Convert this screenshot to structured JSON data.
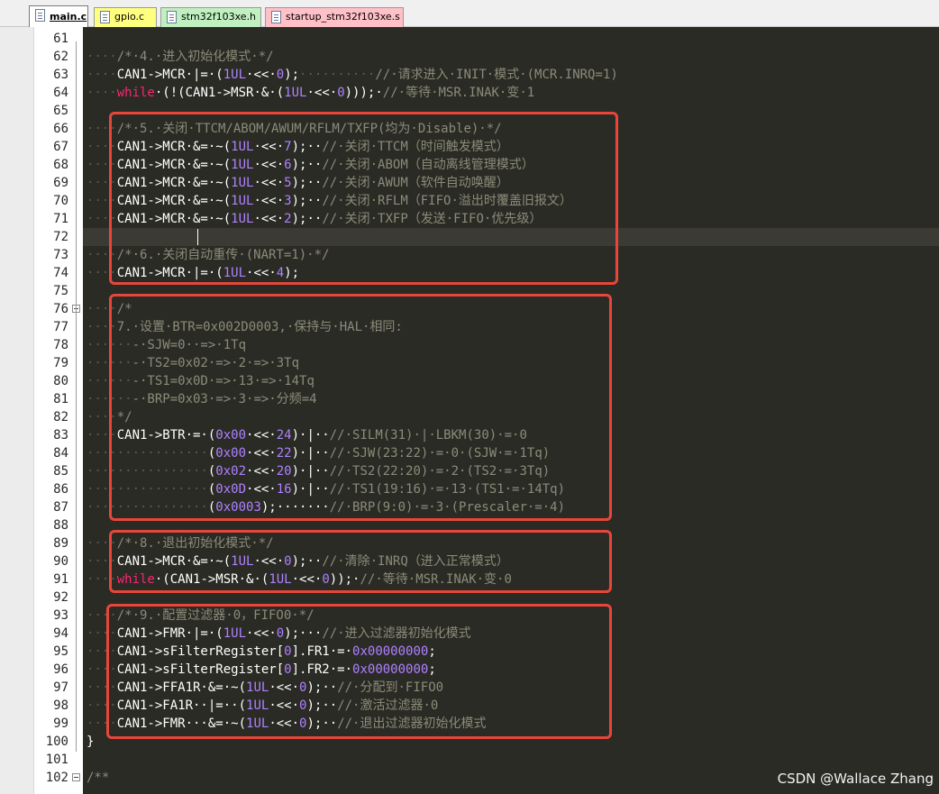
{
  "tabs": [
    {
      "label": "main.c",
      "active": true,
      "color": "#ffffff"
    },
    {
      "label": "gpio.c",
      "active": false,
      "color": "#ffff80"
    },
    {
      "label": "stm32f103xe.h",
      "active": false,
      "color": "#c0f0c0"
    },
    {
      "label": "startup_stm32f103xe.s",
      "active": false,
      "color": "#ffc0c8"
    }
  ],
  "colors": {
    "editor_bg": "#2b2b25",
    "comment": "#8b8b7a",
    "keyword": "#f92672",
    "number": "#ae81ff",
    "text": "#ffffff",
    "highlight_box": "#e8463a"
  },
  "lines": [
    {
      "n": "61",
      "t": []
    },
    {
      "n": "62",
      "t": [
        [
          "ws",
          "····"
        ],
        [
          "c",
          "/*·4.·进入初始化模式·*/"
        ]
      ]
    },
    {
      "n": "63",
      "t": [
        [
          "ws",
          "····"
        ],
        [
          "",
          "CAN1->MCR·|=·("
        ],
        [
          "n",
          "1UL"
        ],
        [
          "",
          "·<<·"
        ],
        [
          "n",
          "0"
        ],
        [
          "",
          ");"
        ],
        [
          "ws",
          "··········"
        ],
        [
          "c",
          "//·请求进入·INIT·模式·(MCR.INRQ=1)"
        ]
      ]
    },
    {
      "n": "64",
      "t": [
        [
          "ws",
          "····"
        ],
        [
          "k",
          "while"
        ],
        [
          "",
          "·(!(CAN1->MSR·&·("
        ],
        [
          "n",
          "1UL"
        ],
        [
          "",
          "·<<·"
        ],
        [
          "n",
          "0"
        ],
        [
          "",
          ")));·"
        ],
        [
          "c",
          "//·等待·MSR.INAK·变·1"
        ]
      ]
    },
    {
      "n": "65",
      "t": []
    },
    {
      "n": "66",
      "t": [
        [
          "ws",
          "····"
        ],
        [
          "c",
          "/*·5.·关闭·TTCM/ABOM/AWUM/RFLM/TXFP(均为·Disable)·*/"
        ]
      ]
    },
    {
      "n": "67",
      "t": [
        [
          "ws",
          "····"
        ],
        [
          "",
          "CAN1->MCR·&=·~("
        ],
        [
          "n",
          "1UL"
        ],
        [
          "",
          "·<<·"
        ],
        [
          "n",
          "7"
        ],
        [
          "",
          ");··"
        ],
        [
          "c",
          "//·关闭·TTCM（时间触发模式）"
        ]
      ]
    },
    {
      "n": "68",
      "t": [
        [
          "ws",
          "····"
        ],
        [
          "",
          "CAN1->MCR·&=·~("
        ],
        [
          "n",
          "1UL"
        ],
        [
          "",
          "·<<·"
        ],
        [
          "n",
          "6"
        ],
        [
          "",
          ");··"
        ],
        [
          "c",
          "//·关闭·ABOM（自动离线管理模式）"
        ]
      ]
    },
    {
      "n": "69",
      "t": [
        [
          "ws",
          "····"
        ],
        [
          "",
          "CAN1->MCR·&=·~("
        ],
        [
          "n",
          "1UL"
        ],
        [
          "",
          "·<<·"
        ],
        [
          "n",
          "5"
        ],
        [
          "",
          ");··"
        ],
        [
          "c",
          "//·关闭·AWUM（软件自动唤醒）"
        ]
      ]
    },
    {
      "n": "70",
      "t": [
        [
          "ws",
          "····"
        ],
        [
          "",
          "CAN1->MCR·&=·~("
        ],
        [
          "n",
          "1UL"
        ],
        [
          "",
          "·<<·"
        ],
        [
          "n",
          "3"
        ],
        [
          "",
          ");··"
        ],
        [
          "c",
          "//·关闭·RFLM（FIFO·溢出时覆盖旧报文）"
        ]
      ]
    },
    {
      "n": "71",
      "t": [
        [
          "ws",
          "····"
        ],
        [
          "",
          "CAN1->MCR·&=·~("
        ],
        [
          "n",
          "1UL"
        ],
        [
          "",
          "·<<·"
        ],
        [
          "n",
          "2"
        ],
        [
          "",
          ");··"
        ],
        [
          "c",
          "//·关闭·TXFP（发送·FIFO·优先级）"
        ]
      ]
    },
    {
      "n": "72",
      "t": [],
      "current": true
    },
    {
      "n": "73",
      "t": [
        [
          "ws",
          "····"
        ],
        [
          "c",
          "/*·6.·关闭自动重传·(NART=1)·*/"
        ]
      ]
    },
    {
      "n": "74",
      "t": [
        [
          "ws",
          "····"
        ],
        [
          "",
          "CAN1->MCR·|=·("
        ],
        [
          "n",
          "1UL"
        ],
        [
          "",
          "·<<·"
        ],
        [
          "n",
          "4"
        ],
        [
          "",
          ");"
        ]
      ]
    },
    {
      "n": "75",
      "t": []
    },
    {
      "n": "76",
      "t": [
        [
          "ws",
          "····"
        ],
        [
          "c",
          "/*"
        ]
      ],
      "fold": true
    },
    {
      "n": "77",
      "t": [
        [
          "ws",
          "····"
        ],
        [
          "c",
          "7.·设置·BTR=0x002D0003,·保持与·HAL·相同:"
        ]
      ]
    },
    {
      "n": "78",
      "t": [
        [
          "ws",
          "······"
        ],
        [
          "c",
          "-·SJW=0··=>·1Tq"
        ]
      ]
    },
    {
      "n": "79",
      "t": [
        [
          "ws",
          "······"
        ],
        [
          "c",
          "-·TS2=0x02·=>·2·=>·3Tq"
        ]
      ]
    },
    {
      "n": "80",
      "t": [
        [
          "ws",
          "······"
        ],
        [
          "c",
          "-·TS1=0x0D·=>·13·=>·14Tq"
        ]
      ]
    },
    {
      "n": "81",
      "t": [
        [
          "ws",
          "······"
        ],
        [
          "c",
          "-·BRP=0x03·=>·3·=>·分频=4"
        ]
      ]
    },
    {
      "n": "82",
      "t": [
        [
          "ws",
          "····"
        ],
        [
          "c",
          "*/"
        ]
      ]
    },
    {
      "n": "83",
      "t": [
        [
          "ws",
          "····"
        ],
        [
          "",
          "CAN1->BTR·=·("
        ],
        [
          "n",
          "0x00"
        ],
        [
          "",
          "·<<·"
        ],
        [
          "n",
          "24"
        ],
        [
          "",
          ")·|··"
        ],
        [
          "c",
          "//·SILM(31)·|·LBKM(30)·=·0"
        ]
      ]
    },
    {
      "n": "84",
      "t": [
        [
          "ws",
          "················"
        ],
        [
          "",
          "("
        ],
        [
          "n",
          "0x00"
        ],
        [
          "",
          "·<<·"
        ],
        [
          "n",
          "22"
        ],
        [
          "",
          ")·|··"
        ],
        [
          "c",
          "//·SJW(23:22)·=·0·(SJW·=·1Tq)"
        ]
      ]
    },
    {
      "n": "85",
      "t": [
        [
          "ws",
          "················"
        ],
        [
          "",
          "("
        ],
        [
          "n",
          "0x02"
        ],
        [
          "",
          "·<<·"
        ],
        [
          "n",
          "20"
        ],
        [
          "",
          ")·|··"
        ],
        [
          "c",
          "//·TS2(22:20)·=·2·(TS2·=·3Tq)"
        ]
      ]
    },
    {
      "n": "86",
      "t": [
        [
          "ws",
          "················"
        ],
        [
          "",
          "("
        ],
        [
          "n",
          "0x0D"
        ],
        [
          "",
          "·<<·"
        ],
        [
          "n",
          "16"
        ],
        [
          "",
          ")·|··"
        ],
        [
          "c",
          "//·TS1(19:16)·=·13·(TS1·=·14Tq)"
        ]
      ]
    },
    {
      "n": "87",
      "t": [
        [
          "ws",
          "················"
        ],
        [
          "",
          "("
        ],
        [
          "n",
          "0x0003"
        ],
        [
          "",
          ");·······"
        ],
        [
          "c",
          "//·BRP(9:0)·=·3·(Prescaler·=·4)"
        ]
      ]
    },
    {
      "n": "88",
      "t": []
    },
    {
      "n": "89",
      "t": [
        [
          "ws",
          "····"
        ],
        [
          "c",
          "/*·8.·退出初始化模式·*/"
        ]
      ]
    },
    {
      "n": "90",
      "t": [
        [
          "ws",
          "····"
        ],
        [
          "",
          "CAN1->MCR·&=·~("
        ],
        [
          "n",
          "1UL"
        ],
        [
          "",
          "·<<·"
        ],
        [
          "n",
          "0"
        ],
        [
          "",
          ");··"
        ],
        [
          "c",
          "//·清除·INRQ（进入正常模式）"
        ]
      ]
    },
    {
      "n": "91",
      "t": [
        [
          "ws",
          "····"
        ],
        [
          "k",
          "while"
        ],
        [
          "",
          "·(CAN1->MSR·&·("
        ],
        [
          "n",
          "1UL"
        ],
        [
          "",
          "·<<·"
        ],
        [
          "n",
          "0"
        ],
        [
          "",
          "));·"
        ],
        [
          "c",
          "//·等待·MSR.INAK·变·0"
        ]
      ]
    },
    {
      "n": "92",
      "t": []
    },
    {
      "n": "93",
      "t": [
        [
          "ws",
          "····"
        ],
        [
          "c",
          "/*·9.·配置过滤器·0，FIFO0·*/"
        ]
      ]
    },
    {
      "n": "94",
      "t": [
        [
          "ws",
          "····"
        ],
        [
          "",
          "CAN1->FMR·|=·("
        ],
        [
          "n",
          "1UL"
        ],
        [
          "",
          "·<<·"
        ],
        [
          "n",
          "0"
        ],
        [
          "",
          ");···"
        ],
        [
          "c",
          "//·进入过滤器初始化模式"
        ]
      ]
    },
    {
      "n": "95",
      "t": [
        [
          "ws",
          "····"
        ],
        [
          "",
          "CAN1->sFilterRegister["
        ],
        [
          "n",
          "0"
        ],
        [
          "",
          "].FR1·=·"
        ],
        [
          "n",
          "0x00000000"
        ],
        [
          "",
          ";"
        ]
      ]
    },
    {
      "n": "96",
      "t": [
        [
          "ws",
          "····"
        ],
        [
          "",
          "CAN1->sFilterRegister["
        ],
        [
          "n",
          "0"
        ],
        [
          "",
          "].FR2·=·"
        ],
        [
          "n",
          "0x00000000"
        ],
        [
          "",
          ";"
        ]
      ]
    },
    {
      "n": "97",
      "t": [
        [
          "ws",
          "····"
        ],
        [
          "",
          "CAN1->FFA1R·&=·~("
        ],
        [
          "n",
          "1UL"
        ],
        [
          "",
          "·<<·"
        ],
        [
          "n",
          "0"
        ],
        [
          "",
          ");··"
        ],
        [
          "c",
          "//·分配到·FIFO0"
        ]
      ]
    },
    {
      "n": "98",
      "t": [
        [
          "ws",
          "····"
        ],
        [
          "",
          "CAN1->FA1R··|=··("
        ],
        [
          "n",
          "1UL"
        ],
        [
          "",
          "·<<·"
        ],
        [
          "n",
          "0"
        ],
        [
          "",
          ");··"
        ],
        [
          "c",
          "//·激活过滤器·0"
        ]
      ]
    },
    {
      "n": "99",
      "t": [
        [
          "ws",
          "····"
        ],
        [
          "",
          "CAN1->FMR···&=·~("
        ],
        [
          "n",
          "1UL"
        ],
        [
          "",
          "·<<·"
        ],
        [
          "n",
          "0"
        ],
        [
          "",
          ");··"
        ],
        [
          "c",
          "//·退出过滤器初始化模式"
        ]
      ]
    },
    {
      "n": "100",
      "t": [
        [
          "",
          "}"
        ]
      ]
    },
    {
      "n": "101",
      "t": []
    },
    {
      "n": "102",
      "t": [
        [
          "c",
          "/**"
        ]
      ],
      "fold": true
    }
  ],
  "watermark": "CSDN @Wallace Zhang"
}
